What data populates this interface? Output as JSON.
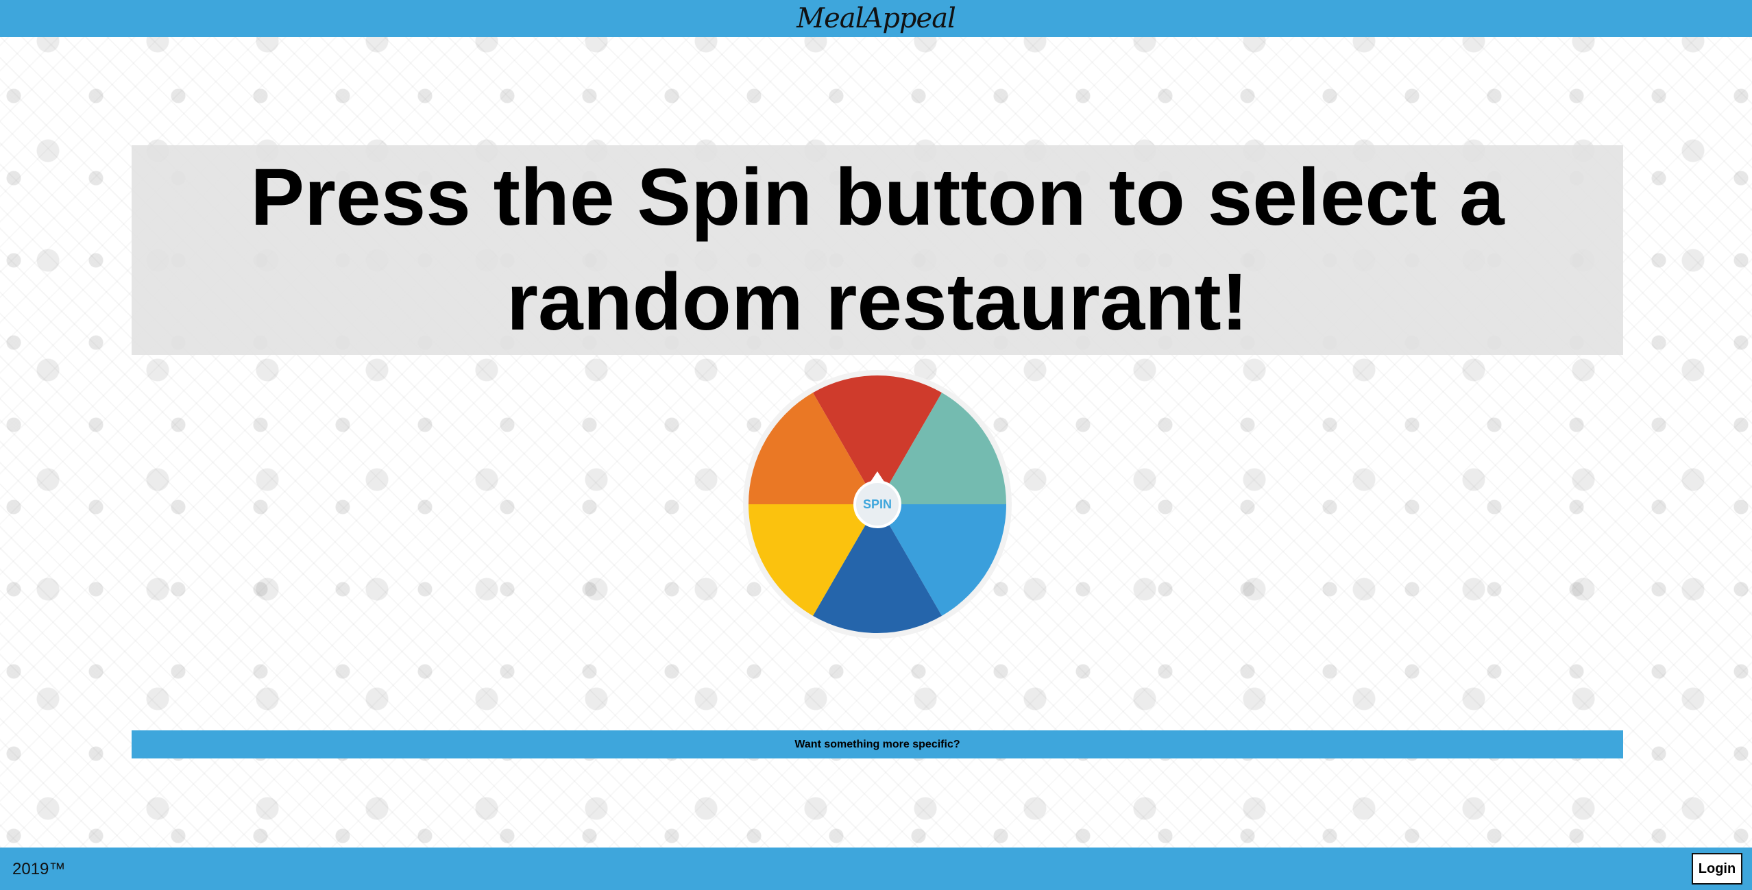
{
  "header": {
    "brand": "MealAppeal",
    "bar_color": "#3ea6dc"
  },
  "main": {
    "headline": "Press the Spin button to select a random restaurant!",
    "wheel": {
      "spin_label": "SPIN",
      "segments": [
        {
          "color": "#cf3b2c"
        },
        {
          "color": "#74bbb0"
        },
        {
          "color": "#3a9fdc"
        },
        {
          "color": "#2565ab"
        },
        {
          "color": "#fbc20e"
        },
        {
          "color": "#ea7825"
        }
      ]
    },
    "specific_link": "Want something more specific?"
  },
  "footer": {
    "copyright": "2019™",
    "login_label": "Login"
  }
}
